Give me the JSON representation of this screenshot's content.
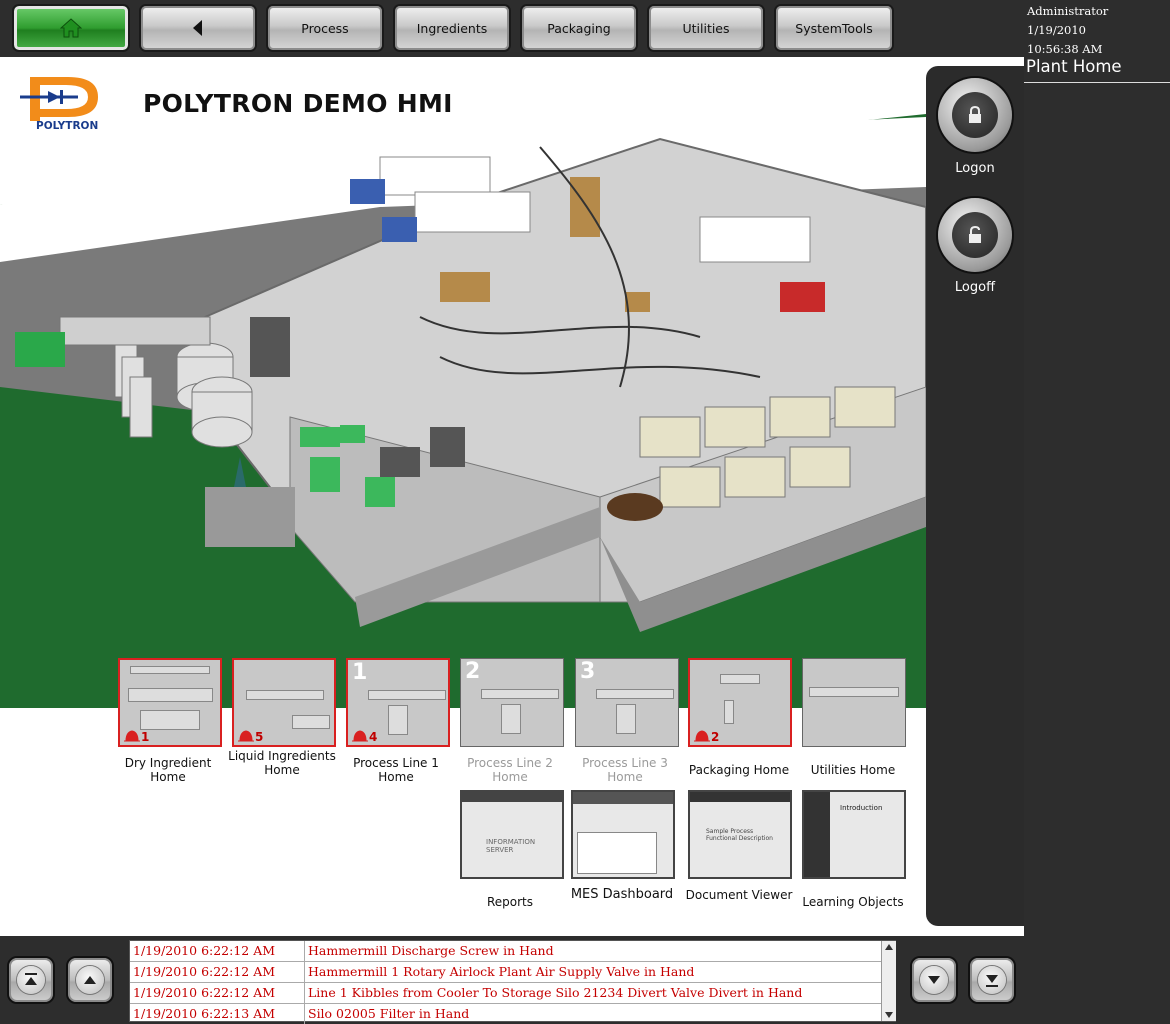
{
  "nav": {
    "home_icon": "home-icon",
    "back_icon": "back-arrow-icon",
    "buttons": [
      "Process",
      "Ingredients",
      "Packaging",
      "Utilities",
      "SystemTools"
    ]
  },
  "user": {
    "name": "Administrator",
    "date": "1/19/2010",
    "time": "10:56:38 AM"
  },
  "page_title": "Plant Home",
  "header": {
    "logo_text": "POLYTRON",
    "title": "POLYTRON DEMO HMI"
  },
  "side": {
    "logon_label": "Logon",
    "logoff_label": "Logoff"
  },
  "thumbnails": [
    {
      "label": "Dry Ingredient Home",
      "alarm_count": "1",
      "number": ""
    },
    {
      "label": "Liquid Ingredients Home",
      "alarm_count": "5",
      "number": ""
    },
    {
      "label": "Process Line 1 Home",
      "alarm_count": "4",
      "number": "1"
    },
    {
      "label": "Process Line 2 Home",
      "alarm_count": "",
      "number": "2"
    },
    {
      "label": "Process Line 3 Home",
      "alarm_count": "",
      "number": "3"
    },
    {
      "label": "Packaging Home",
      "alarm_count": "2",
      "number": ""
    },
    {
      "label": "Utilities Home",
      "alarm_count": "",
      "number": ""
    }
  ],
  "documents": [
    {
      "label": "Reports",
      "thumb_text": "INFORMATION SERVER"
    },
    {
      "label": "MES Dashboard",
      "thumb_text": ""
    },
    {
      "label": "Document Viewer",
      "thumb_text": "Sample Process Functional Description"
    },
    {
      "label": "Learning Objects",
      "thumb_text": "Introduction"
    }
  ],
  "alarms": [
    {
      "time": "1/19/2010 6:22:12 AM",
      "message": "Hammermill Discharge Screw in Hand"
    },
    {
      "time": "1/19/2010 6:22:12 AM",
      "message": "Hammermill 1 Rotary Airlock Plant Air Supply Valve in Hand"
    },
    {
      "time": "1/19/2010 6:22:12 AM",
      "message": "Line 1 Kibbles from Cooler To Storage Silo 21234 Divert Valve Divert in Hand"
    },
    {
      "time": "1/19/2010 6:22:13 AM",
      "message": "Silo 02005 Filter in Hand"
    }
  ],
  "colors": {
    "alarm_red": "#c40000",
    "ground_green": "#1e6a2e",
    "home_green": "#2f9d2f"
  }
}
